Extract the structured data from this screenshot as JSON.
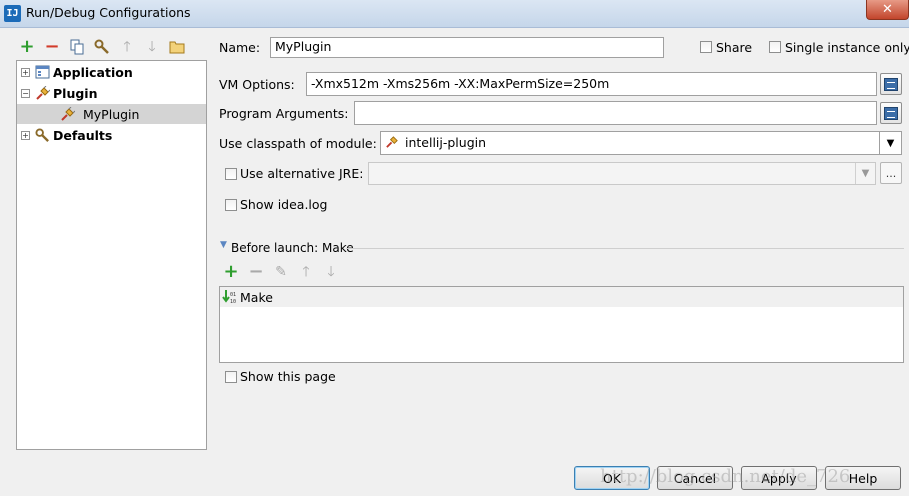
{
  "window": {
    "title": "Run/Debug Configurations",
    "app_icon_text": "IJ"
  },
  "toolbar": {
    "icons": [
      "add-icon",
      "remove-icon",
      "copy-icon",
      "wrench-icon",
      "move-up-icon",
      "move-down-icon",
      "folder-icon"
    ]
  },
  "tree": {
    "items": [
      {
        "label": "Application",
        "bold": true,
        "expanded": false
      },
      {
        "label": "Plugin",
        "bold": true,
        "expanded": true
      },
      {
        "label": "MyPlugin",
        "bold": false,
        "selected": true
      },
      {
        "label": "Defaults",
        "bold": true,
        "expanded": false
      }
    ]
  },
  "form": {
    "name_label": "Name:",
    "name_value": "MyPlugin",
    "share_label": "Share",
    "share_checked": false,
    "single_instance_label": "Single instance only",
    "single_instance_checked": false,
    "vm_options_label": "VM Options:",
    "vm_options_value": "-Xmx512m -Xms256m -XX:MaxPermSize=250m",
    "program_args_label": "Program Arguments:",
    "program_args_value": "",
    "classpath_label": "Use classpath of module:",
    "classpath_value": "intellij-plugin",
    "alt_jre_label": "Use alternative JRE:",
    "alt_jre_checked": false,
    "alt_jre_value": "",
    "ellipsis": "...",
    "show_log_label": "Show idea.log",
    "show_log_checked": false
  },
  "before_launch": {
    "header": "Before launch: Make",
    "items": [
      "Make"
    ]
  },
  "show_page_label": "Show this page",
  "buttons": {
    "ok": "OK",
    "cancel": "Cancel",
    "apply": "Apply",
    "help": "Help"
  },
  "watermark": "http://blog.csdn.net/de_726"
}
